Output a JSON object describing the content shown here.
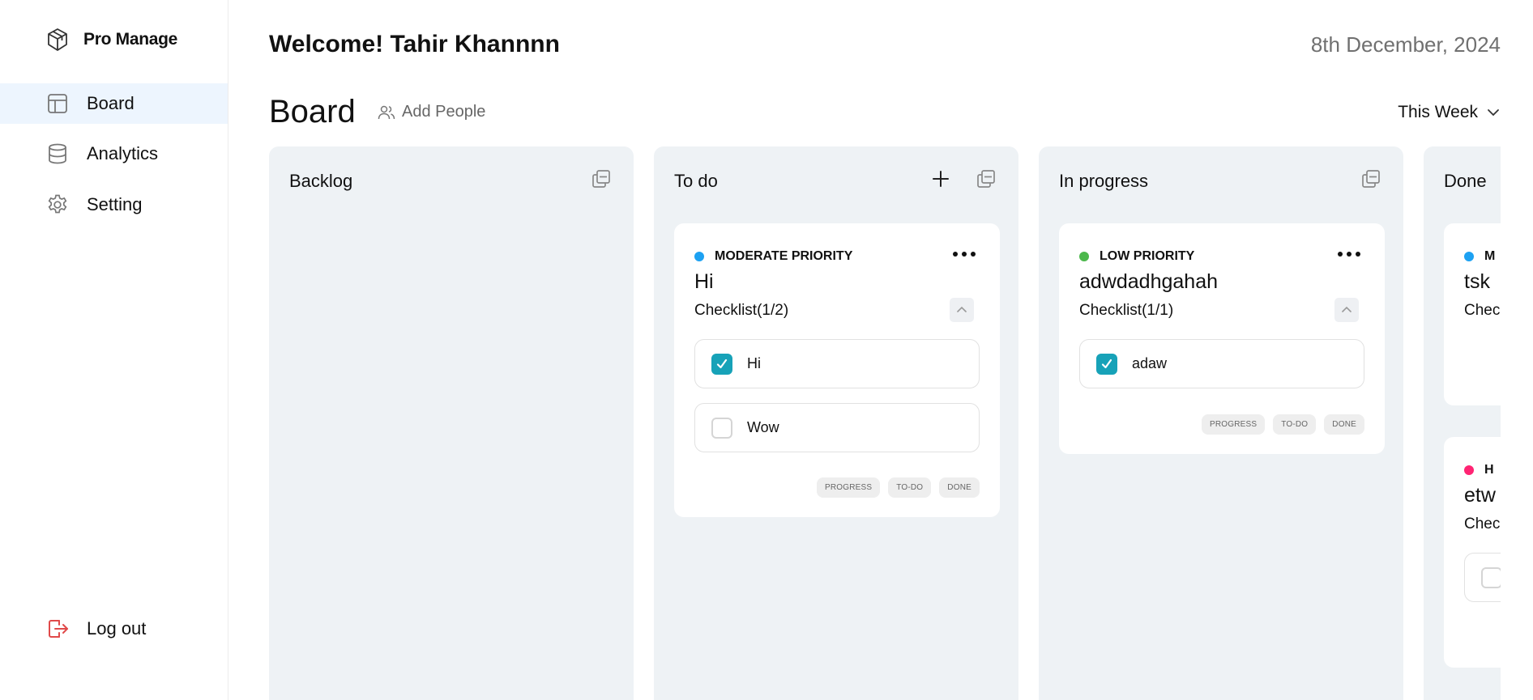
{
  "app": {
    "name": "Pro Manage"
  },
  "sidebar": {
    "items": [
      {
        "label": "Board",
        "icon": "layout-icon",
        "active": true
      },
      {
        "label": "Analytics",
        "icon": "database-icon",
        "active": false
      },
      {
        "label": "Setting",
        "icon": "gear-icon",
        "active": false
      }
    ],
    "logout_label": "Log out"
  },
  "header": {
    "welcome": "Welcome! Tahir Khannnn",
    "date": "8th December, 2024",
    "board_title": "Board",
    "add_people": "Add People",
    "filter": "This Week"
  },
  "colors": {
    "moderate": "#1da1f2",
    "low": "#4cb84c",
    "high": "#ff2473",
    "accent_check": "#17a2b8",
    "active_nav": "#edf5fe"
  },
  "columns": [
    {
      "title": "Backlog"
    },
    {
      "title": "To do",
      "cards": [
        {
          "priority": "MODERATE PRIORITY",
          "title": "Hi",
          "checklist_label": "Checklist(1/2)",
          "items": [
            {
              "text": "Hi",
              "checked": true
            },
            {
              "text": "Wow",
              "checked": false
            }
          ],
          "chips": [
            "PROGRESS",
            "TO-DO",
            "DONE"
          ]
        }
      ]
    },
    {
      "title": "In progress",
      "cards": [
        {
          "priority": "LOW PRIORITY",
          "title": "adwdadhgahah",
          "checklist_label": "Checklist(1/1)",
          "items": [
            {
              "text": "adaw",
              "checked": true
            }
          ],
          "chips": [
            "PROGRESS",
            "TO-DO",
            "DONE"
          ]
        }
      ]
    },
    {
      "title": "Done",
      "cards": [
        {
          "priority_partial": "M",
          "title": "tsk",
          "checklist_partial": "Chec"
        },
        {
          "priority_partial": "H",
          "title_partial": "etw",
          "checklist_partial": "Chec"
        }
      ]
    }
  ]
}
